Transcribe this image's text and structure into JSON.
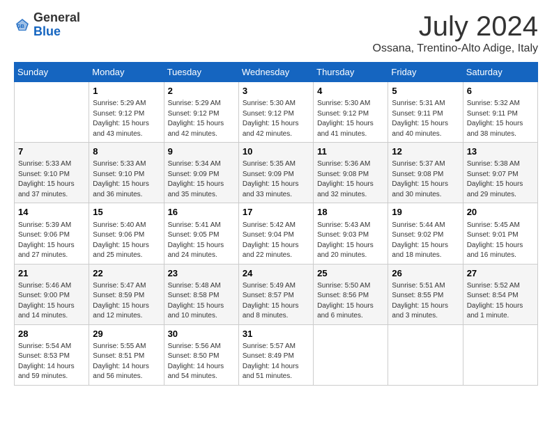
{
  "header": {
    "logo_general": "General",
    "logo_blue": "Blue",
    "month_year": "July 2024",
    "location": "Ossana, Trentino-Alto Adige, Italy"
  },
  "days_of_week": [
    "Sunday",
    "Monday",
    "Tuesday",
    "Wednesday",
    "Thursday",
    "Friday",
    "Saturday"
  ],
  "weeks": [
    [
      {
        "day": "",
        "info": ""
      },
      {
        "day": "1",
        "info": "Sunrise: 5:29 AM\nSunset: 9:12 PM\nDaylight: 15 hours\nand 43 minutes."
      },
      {
        "day": "2",
        "info": "Sunrise: 5:29 AM\nSunset: 9:12 PM\nDaylight: 15 hours\nand 42 minutes."
      },
      {
        "day": "3",
        "info": "Sunrise: 5:30 AM\nSunset: 9:12 PM\nDaylight: 15 hours\nand 42 minutes."
      },
      {
        "day": "4",
        "info": "Sunrise: 5:30 AM\nSunset: 9:12 PM\nDaylight: 15 hours\nand 41 minutes."
      },
      {
        "day": "5",
        "info": "Sunrise: 5:31 AM\nSunset: 9:11 PM\nDaylight: 15 hours\nand 40 minutes."
      },
      {
        "day": "6",
        "info": "Sunrise: 5:32 AM\nSunset: 9:11 PM\nDaylight: 15 hours\nand 38 minutes."
      }
    ],
    [
      {
        "day": "7",
        "info": "Sunrise: 5:33 AM\nSunset: 9:10 PM\nDaylight: 15 hours\nand 37 minutes."
      },
      {
        "day": "8",
        "info": "Sunrise: 5:33 AM\nSunset: 9:10 PM\nDaylight: 15 hours\nand 36 minutes."
      },
      {
        "day": "9",
        "info": "Sunrise: 5:34 AM\nSunset: 9:09 PM\nDaylight: 15 hours\nand 35 minutes."
      },
      {
        "day": "10",
        "info": "Sunrise: 5:35 AM\nSunset: 9:09 PM\nDaylight: 15 hours\nand 33 minutes."
      },
      {
        "day": "11",
        "info": "Sunrise: 5:36 AM\nSunset: 9:08 PM\nDaylight: 15 hours\nand 32 minutes."
      },
      {
        "day": "12",
        "info": "Sunrise: 5:37 AM\nSunset: 9:08 PM\nDaylight: 15 hours\nand 30 minutes."
      },
      {
        "day": "13",
        "info": "Sunrise: 5:38 AM\nSunset: 9:07 PM\nDaylight: 15 hours\nand 29 minutes."
      }
    ],
    [
      {
        "day": "14",
        "info": "Sunrise: 5:39 AM\nSunset: 9:06 PM\nDaylight: 15 hours\nand 27 minutes."
      },
      {
        "day": "15",
        "info": "Sunrise: 5:40 AM\nSunset: 9:06 PM\nDaylight: 15 hours\nand 25 minutes."
      },
      {
        "day": "16",
        "info": "Sunrise: 5:41 AM\nSunset: 9:05 PM\nDaylight: 15 hours\nand 24 minutes."
      },
      {
        "day": "17",
        "info": "Sunrise: 5:42 AM\nSunset: 9:04 PM\nDaylight: 15 hours\nand 22 minutes."
      },
      {
        "day": "18",
        "info": "Sunrise: 5:43 AM\nSunset: 9:03 PM\nDaylight: 15 hours\nand 20 minutes."
      },
      {
        "day": "19",
        "info": "Sunrise: 5:44 AM\nSunset: 9:02 PM\nDaylight: 15 hours\nand 18 minutes."
      },
      {
        "day": "20",
        "info": "Sunrise: 5:45 AM\nSunset: 9:01 PM\nDaylight: 15 hours\nand 16 minutes."
      }
    ],
    [
      {
        "day": "21",
        "info": "Sunrise: 5:46 AM\nSunset: 9:00 PM\nDaylight: 15 hours\nand 14 minutes."
      },
      {
        "day": "22",
        "info": "Sunrise: 5:47 AM\nSunset: 8:59 PM\nDaylight: 15 hours\nand 12 minutes."
      },
      {
        "day": "23",
        "info": "Sunrise: 5:48 AM\nSunset: 8:58 PM\nDaylight: 15 hours\nand 10 minutes."
      },
      {
        "day": "24",
        "info": "Sunrise: 5:49 AM\nSunset: 8:57 PM\nDaylight: 15 hours\nand 8 minutes."
      },
      {
        "day": "25",
        "info": "Sunrise: 5:50 AM\nSunset: 8:56 PM\nDaylight: 15 hours\nand 6 minutes."
      },
      {
        "day": "26",
        "info": "Sunrise: 5:51 AM\nSunset: 8:55 PM\nDaylight: 15 hours\nand 3 minutes."
      },
      {
        "day": "27",
        "info": "Sunrise: 5:52 AM\nSunset: 8:54 PM\nDaylight: 15 hours\nand 1 minute."
      }
    ],
    [
      {
        "day": "28",
        "info": "Sunrise: 5:54 AM\nSunset: 8:53 PM\nDaylight: 14 hours\nand 59 minutes."
      },
      {
        "day": "29",
        "info": "Sunrise: 5:55 AM\nSunset: 8:51 PM\nDaylight: 14 hours\nand 56 minutes."
      },
      {
        "day": "30",
        "info": "Sunrise: 5:56 AM\nSunset: 8:50 PM\nDaylight: 14 hours\nand 54 minutes."
      },
      {
        "day": "31",
        "info": "Sunrise: 5:57 AM\nSunset: 8:49 PM\nDaylight: 14 hours\nand 51 minutes."
      },
      {
        "day": "",
        "info": ""
      },
      {
        "day": "",
        "info": ""
      },
      {
        "day": "",
        "info": ""
      }
    ]
  ]
}
